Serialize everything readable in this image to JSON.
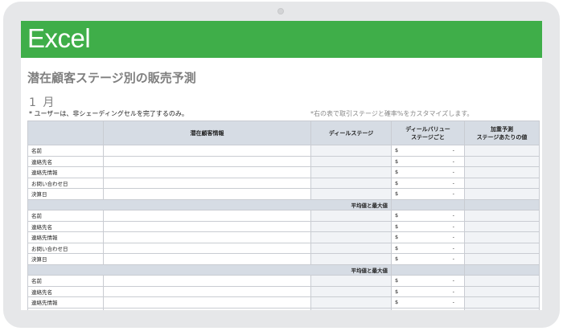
{
  "app": {
    "banner_title": "Excel"
  },
  "sheet": {
    "title": "潜在顧客ステージ別の販売予測",
    "month": "1 月",
    "note_left": "* ユーザーは、非シェーディングセルを完了するのみ。",
    "note_right": "*右の表で取引ステージと確率%をカスタマイズします。"
  },
  "table": {
    "headers": [
      "潜在顧客情報",
      "ディールステージ",
      "ディールバリュー\nステージごと",
      "加重予測\nステージあたりの値"
    ],
    "row_labels": [
      "名前",
      "連絡先名",
      "連絡先情報",
      "お問い合わせ日",
      "決算日"
    ],
    "currency_symbol": "$",
    "empty_value": "-",
    "subtotal_label": "平均値と最大値"
  }
}
